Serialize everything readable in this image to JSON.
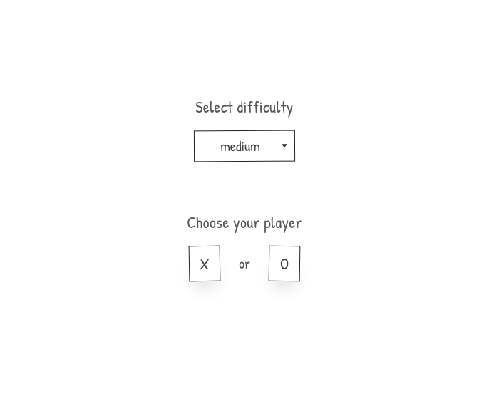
{
  "difficulty": {
    "label": "Select difficulty",
    "selected": "medium"
  },
  "player": {
    "label": "Choose your player",
    "option_x": "X",
    "separator": "or",
    "option_o": "O"
  }
}
